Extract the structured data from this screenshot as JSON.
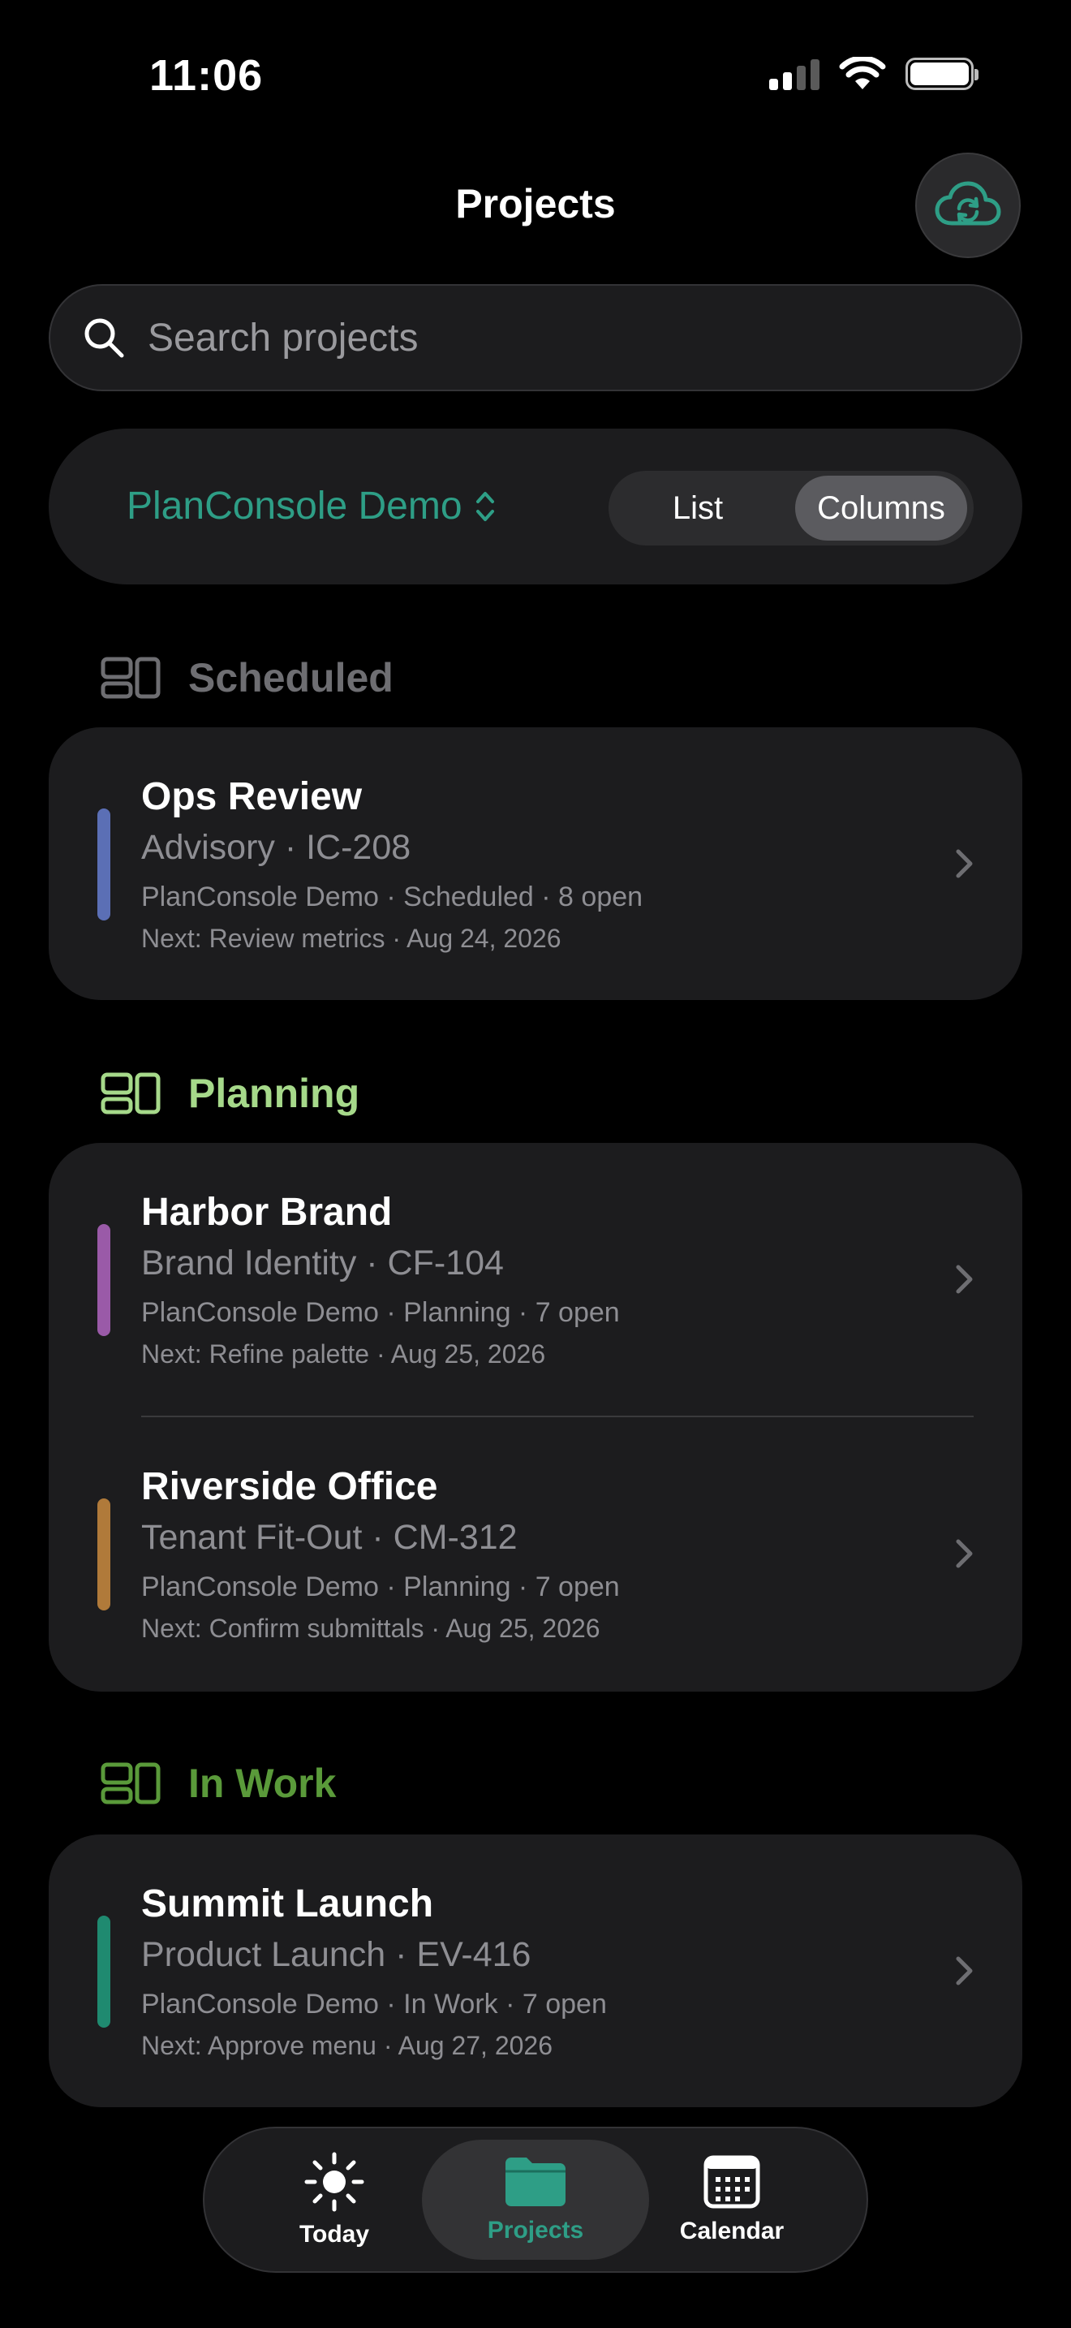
{
  "status_bar": {
    "time": "11:06"
  },
  "header": {
    "title": "Projects",
    "sync_icon": "cloud-sync-icon"
  },
  "search": {
    "placeholder": "Search projects",
    "value": ""
  },
  "controls": {
    "workspace": "PlanConsole Demo",
    "view_options": [
      "List",
      "Columns"
    ],
    "selected_view": "Columns"
  },
  "colors": {
    "accent": "#2e9e86",
    "scheduled_header": "#6e6e72",
    "planning_header": "#a6d98a",
    "in_work_header": "#5a9a3a",
    "ops_review": "#5b6fb5",
    "harbor_brand": "#9a5aa8",
    "riverside_office": "#b07a3a",
    "summit_launch": "#1f8a70"
  },
  "sections": [
    {
      "name": "Scheduled",
      "projects": [
        {
          "title": "Ops Review",
          "subtitle": "Advisory · IC-208",
          "meta": "PlanConsole Demo  · Scheduled  · 8 open",
          "next": "Next: Review metrics · Aug 24, 2026"
        }
      ]
    },
    {
      "name": "Planning",
      "projects": [
        {
          "title": "Harbor Brand",
          "subtitle": "Brand Identity · CF-104",
          "meta": "PlanConsole Demo  · Planning  · 7 open",
          "next": "Next: Refine palette · Aug 25, 2026"
        },
        {
          "title": "Riverside Office",
          "subtitle": "Tenant Fit-Out · CM-312",
          "meta": "PlanConsole Demo  · Planning  · 7 open",
          "next": "Next: Confirm submittals · Aug 25, 2026"
        }
      ]
    },
    {
      "name": "In Work",
      "projects": [
        {
          "title": "Summit Launch",
          "subtitle": "Product Launch · EV-416",
          "meta": "PlanConsole Demo · In Work  · 7 open",
          "next": "Next: Approve menu · Aug 27, 2026"
        }
      ]
    }
  ],
  "tabs": [
    {
      "label": "Today",
      "icon": "sun-icon"
    },
    {
      "label": "Projects",
      "icon": "folder-icon",
      "selected": true
    },
    {
      "label": "Calendar",
      "icon": "calendar-icon"
    }
  ]
}
